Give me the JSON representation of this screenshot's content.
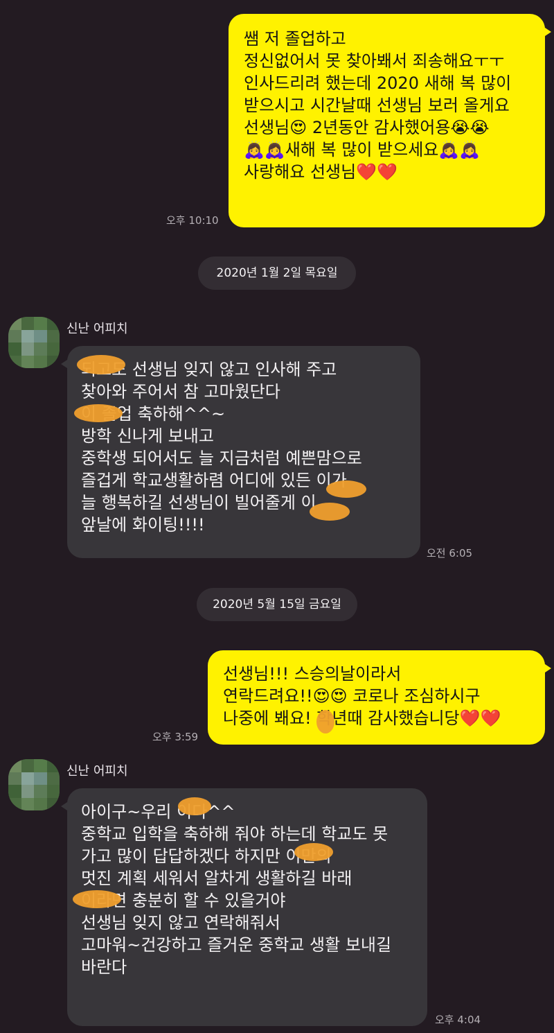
{
  "messages": [
    {
      "sender": "me",
      "time": "오후 10:10",
      "lines": [
        "쌤 저 졸업하고",
        "정신없어서 못 찾아봬서 죄송해요ㅜㅜ",
        "인사드리려 했는데 2020 새해 복 많이",
        "받으시고 시간날때 선생님 보러 올게요",
        "선생님😍 2년동안 감사했어용😭😭",
        "",
        "🙇‍♀️🙇‍♀️새해 복 많이 받으세요🙇‍♀️🙇‍♀️",
        "사랑해요 선생님❤️❤️"
      ]
    },
    {
      "sender": "date",
      "label": "2020년 1월 2일 목요일"
    },
    {
      "sender": "신난 어피치",
      "time": "오전 6:05",
      "lines": [
        "       되고도 선생님 잊지 않고 인사해 주고",
        "찾아와 주어서 참 고마웠단다",
        "       이 졸업 축하해^^~",
        "방학 신나게 보내고",
        "중학생 되어서도 늘 지금처럼 예쁜맘으로",
        "즐겁게 학교생활하렴 어디에 있든       이가",
        "늘 행복하길 선생님이 빌어줄게       이",
        "앞날에 화이팅!!!!"
      ]
    },
    {
      "sender": "date",
      "label": "2020년 5월 15일 금요일"
    },
    {
      "sender": "me",
      "time": "오후 3:59",
      "lines": [
        "선생님!!! 스승의날이라서",
        "연락드려요!!😍😍 코로나 조심하시구",
        "나중에 봬요!    학년때 감사했습니당❤️❤️"
      ]
    },
    {
      "sender": "신난 어피치",
      "time": "오후 4:04",
      "lines": [
        "아이구~우리       이다^^",
        "중학교 입학을 축하해 줘야 하는데 학교도 못",
        "가고 많이 답답하겠다 하지만       이만의",
        "멋진 계획 세워서 알차게 생활하길 바래",
        "       이라면 충분히 할 수 있을거야",
        "선생님 잊지 않고 연락해줘서",
        "고마워~건강하고 즐거운 중학교 생활 보내길",
        "바란다"
      ]
    }
  ],
  "colors": {
    "background": "#231b22",
    "my_bubble": "#fff200",
    "their_bubble": "#38363a",
    "date_pill": "#332d33",
    "redaction": "#ef9f2d"
  },
  "icons": {
    "avatar": "pixelated-profile-avatar"
  }
}
